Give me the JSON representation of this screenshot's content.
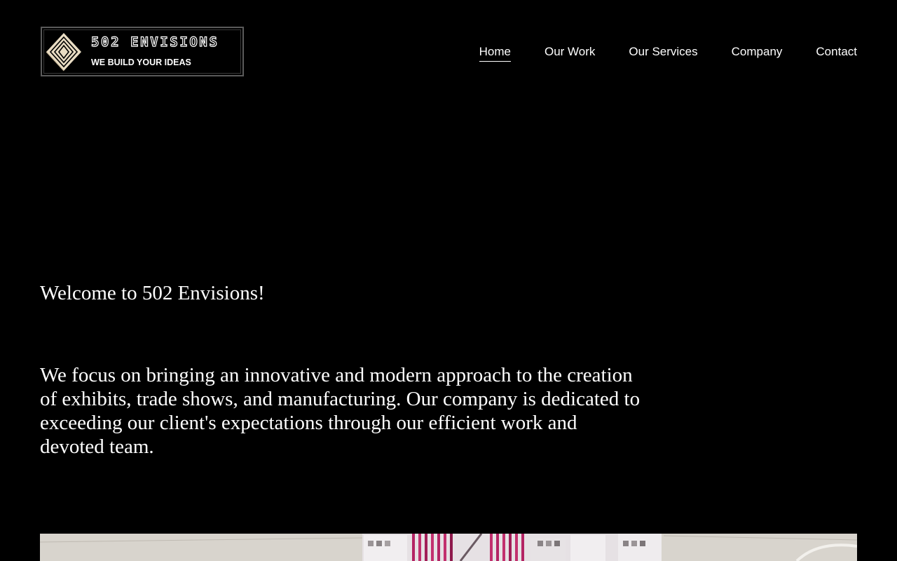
{
  "logo": {
    "name": "502 ENVISIONS",
    "tagline": "WE BUILD YOUR IDEAS",
    "mark_icon": "diamond-logo-icon",
    "accent_color": "#e9dcc3"
  },
  "nav": {
    "items": [
      {
        "label": "Home",
        "active": true
      },
      {
        "label": "Our Work",
        "active": false
      },
      {
        "label": "Our Services",
        "active": false
      },
      {
        "label": "Company",
        "active": false
      },
      {
        "label": "Contact",
        "active": false
      }
    ]
  },
  "hero": {
    "heading": "Welcome to 502 Envisions!",
    "body": "We focus on bringing an innovative and modern approach to the creation of exhibits, trade shows, and manufacturing. Our company is dedicated to exceeding our client's expectations through our efficient work and devoted team."
  },
  "colors": {
    "background": "#000000",
    "text": "#ffffff",
    "photo_accent": "#c2306e"
  }
}
